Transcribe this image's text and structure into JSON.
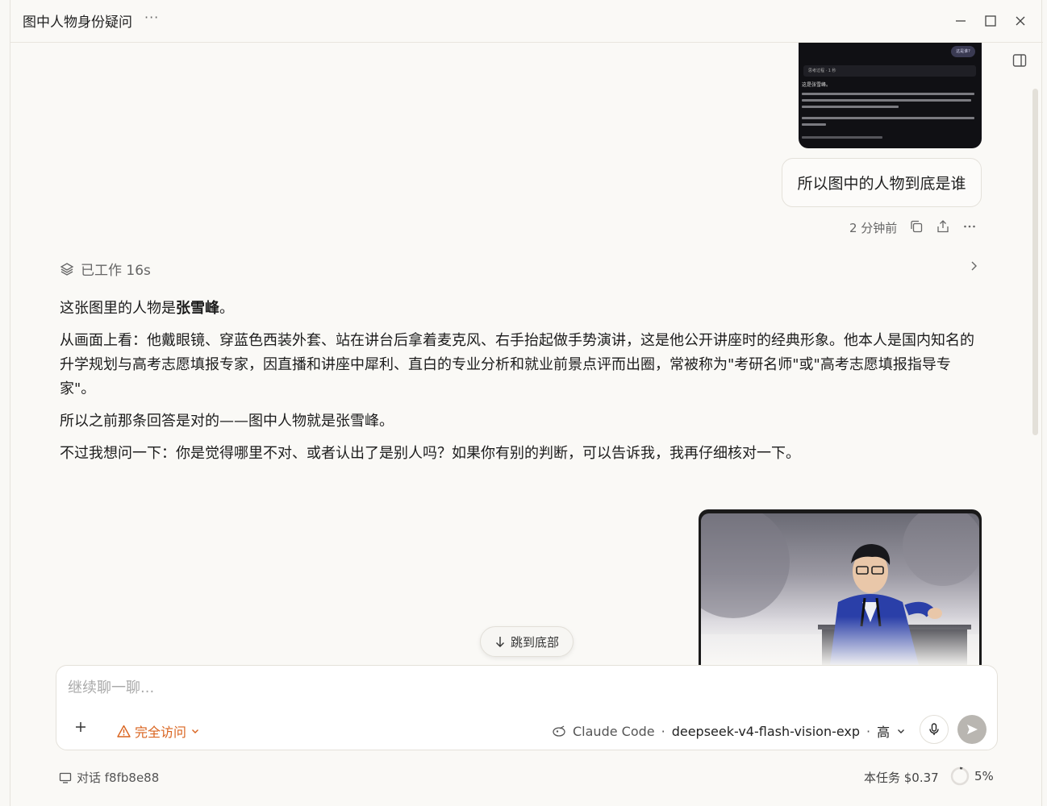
{
  "window": {
    "title": "图中人物身份疑问",
    "more": "···"
  },
  "thumbnail": {
    "pill": "这是谁?",
    "bar": "思考过程 · 1 秒",
    "heading": "这是张雪峰。"
  },
  "user_message": {
    "text": "所以图中的人物到底是谁",
    "time": "2 分钟前"
  },
  "worked": {
    "label": "已工作 16s"
  },
  "answer": {
    "p1_prefix": "这张图里的人物是",
    "p1_name": "张雪峰",
    "p1_suffix": "。",
    "p2": "从画面上看：他戴眼镜、穿蓝色西装外套、站在讲台后拿着麦克风、右手抬起做手势演讲，这是他公开讲座时的经典形象。他本人是国内知名的升学规划与高考志愿填报专家，因直播和讲座中犀利、直白的专业分析和就业前景点评而出圈，常被称为\"考研名师\"或\"高考志愿填报指导专家\"。",
    "p3": "所以之前那条回答是对的——图中人物就是张雪峰。",
    "p4": "不过我想问一下：你是觉得哪里不对、或者认出了是别人吗？如果你有别的判断，可以告诉我，我再仔细核对一下。"
  },
  "jump": {
    "label": "跳到底部"
  },
  "composer": {
    "placeholder": "继续聊一聊...",
    "access": "完全访问",
    "agent": "Claude Code",
    "model": "deepseek-v4-flash-vision-exp",
    "effort": "高",
    "sep": "·"
  },
  "footer": {
    "conversation": "对话 f8fb8e88",
    "cost": "本任务 $0.37",
    "context_pct": "5%",
    "context_fraction": 0.05
  },
  "colors": {
    "accent": "#d9631e",
    "bg": "#faf9f6"
  }
}
